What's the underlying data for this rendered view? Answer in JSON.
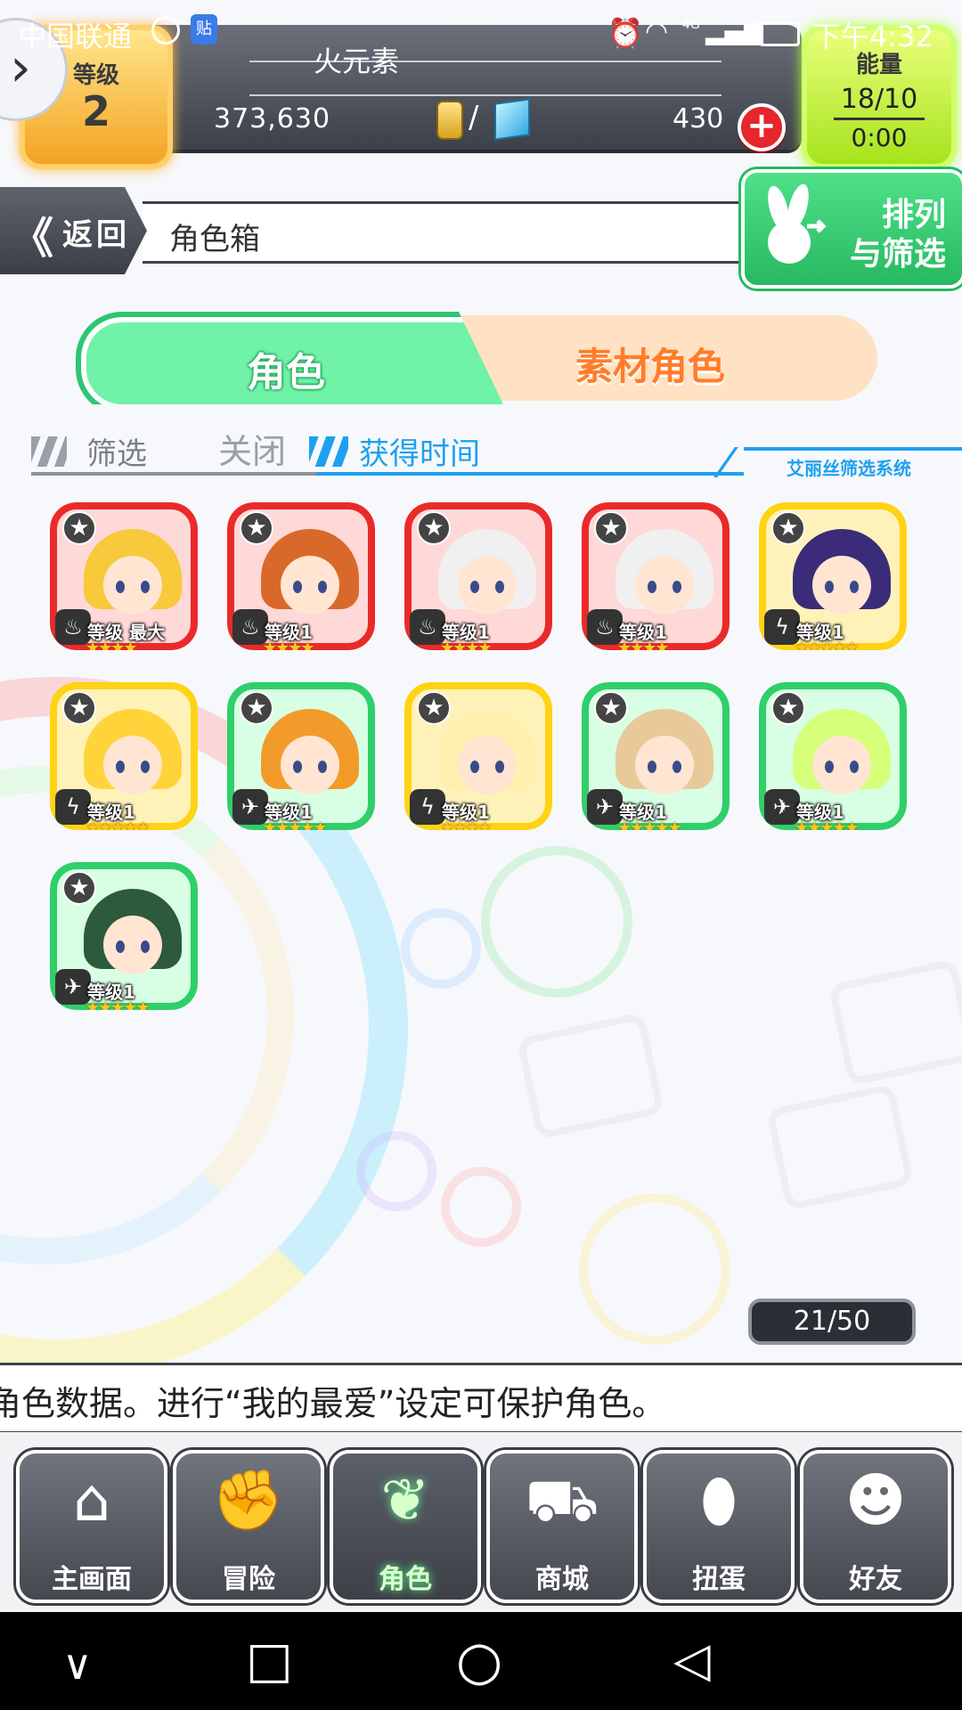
{
  "status_bar": {
    "carrier": "中国联通",
    "app_badge": "贴",
    "network": "4G",
    "time": "下午4:32"
  },
  "header": {
    "level_label": "等级",
    "level_value": "2",
    "element_name": "火元素",
    "gold": "373,630",
    "separator": "/",
    "gems": "430",
    "plus": "+",
    "energy_label": "能量",
    "energy_value": "18/10",
    "energy_timer": "0:00",
    "back_arrow": "›"
  },
  "title_row": {
    "back_chevron": "《",
    "back_label": "返回",
    "page_title": "角色箱",
    "sort_label_1": "排列",
    "sort_label_2": "与筛选"
  },
  "tabs": [
    {
      "label": "角色",
      "active": true
    },
    {
      "label": "素材角色",
      "active": false
    }
  ],
  "filter": {
    "label": "筛选",
    "state": "关闭",
    "sort_by": "获得时间",
    "system_label": "艾丽丝筛选系统"
  },
  "characters": [
    {
      "element": "fire",
      "level": "等级 最大",
      "rarity": "★★★★"
    },
    {
      "element": "fire",
      "level": "等级1",
      "rarity": "★★★★"
    },
    {
      "element": "fire",
      "level": "等级1",
      "rarity": "★★★★"
    },
    {
      "element": "fire",
      "level": "等级1",
      "rarity": "★★★★"
    },
    {
      "element": "thunder",
      "level": "等级1",
      "rarity": "★★★★★"
    },
    {
      "element": "thunder",
      "level": "等级1",
      "rarity": "★★★★★"
    },
    {
      "element": "wind",
      "level": "等级1",
      "rarity": "★★★★★"
    },
    {
      "element": "thunder",
      "level": "等级1",
      "rarity": "★★★★"
    },
    {
      "element": "wind",
      "level": "等级1",
      "rarity": "★★★★★"
    },
    {
      "element": "wind",
      "level": "等级1",
      "rarity": "★★★★★"
    },
    {
      "element": "wind",
      "level": "等级1",
      "rarity": "★★★★★"
    }
  ],
  "card_star": "★",
  "attribute_glyphs": {
    "fire": "♨",
    "thunder": "ϟ",
    "wind": "✈"
  },
  "counter": "21/50",
  "message": "角色数据。进行“我的最爱”设定可保护角色。",
  "bottom_nav": [
    {
      "label": "主画面",
      "icon": "home-icon",
      "glyph": "⌂",
      "active": false
    },
    {
      "label": "冒险",
      "icon": "handshake-icon",
      "glyph": "✊",
      "active": false
    },
    {
      "label": "角色",
      "icon": "bunny-icon",
      "glyph": "❦",
      "active": true
    },
    {
      "label": "商城",
      "icon": "cart-icon",
      "glyph": "⛟",
      "active": false
    },
    {
      "label": "扭蛋",
      "icon": "egg-icon",
      "glyph": "⬮",
      "active": false
    },
    {
      "label": "好友",
      "icon": "friends-icon",
      "glyph": "☻",
      "active": false
    }
  ],
  "system_nav": {
    "down": "∨",
    "recent": "□",
    "home": "○",
    "back": "◁"
  },
  "colors": {
    "fire": "#ea2a2a",
    "thunder": "#ffd314",
    "wind": "#2fcf6a",
    "tab_active": "#70f2a8",
    "tab_inactive_text": "#ff7d2a",
    "accent_blue": "#1ea0f0"
  }
}
